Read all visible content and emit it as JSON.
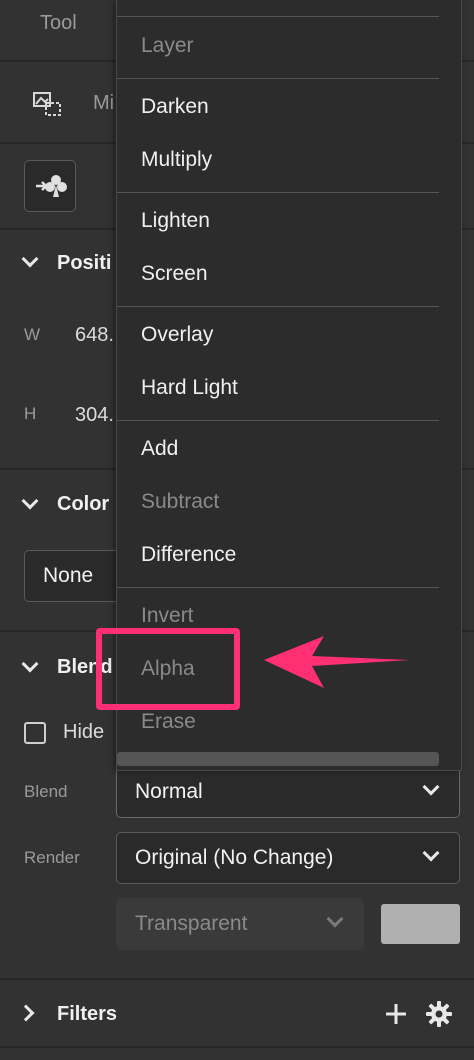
{
  "panel": {
    "tool_tab": "Tool",
    "mirror_label": "Mi",
    "position_section": "Positi",
    "w_label": "W",
    "w_value": "648.",
    "h_label": "H",
    "h_value": "304.",
    "color_section": "Color",
    "color_value": "None",
    "blend_section": "Blend",
    "hide_label": "Hide",
    "blend_label": "Blend",
    "blend_value": "Normal",
    "render_label": "Render",
    "render_value": "Original (No Change)",
    "transparent_value": "Transparent",
    "filters_section": "Filters"
  },
  "dropdown": {
    "items": [
      {
        "label": "Layer",
        "disabled": true
      },
      {
        "label": "Darken",
        "disabled": false
      },
      {
        "label": "Multiply",
        "disabled": false
      },
      {
        "label": "Lighten",
        "disabled": false
      },
      {
        "label": "Screen",
        "disabled": false
      },
      {
        "label": "Overlay",
        "disabled": false
      },
      {
        "label": "Hard Light",
        "disabled": false
      },
      {
        "label": "Add",
        "disabled": false
      },
      {
        "label": "Subtract",
        "disabled": true
      },
      {
        "label": "Difference",
        "disabled": false
      },
      {
        "label": "Invert",
        "disabled": true
      },
      {
        "label": "Alpha",
        "disabled": true
      },
      {
        "label": "Erase",
        "disabled": true
      }
    ]
  },
  "colors": {
    "highlight": "#ff2f73",
    "panel_bg": "#323232",
    "menu_bg": "#2c2c2c"
  }
}
